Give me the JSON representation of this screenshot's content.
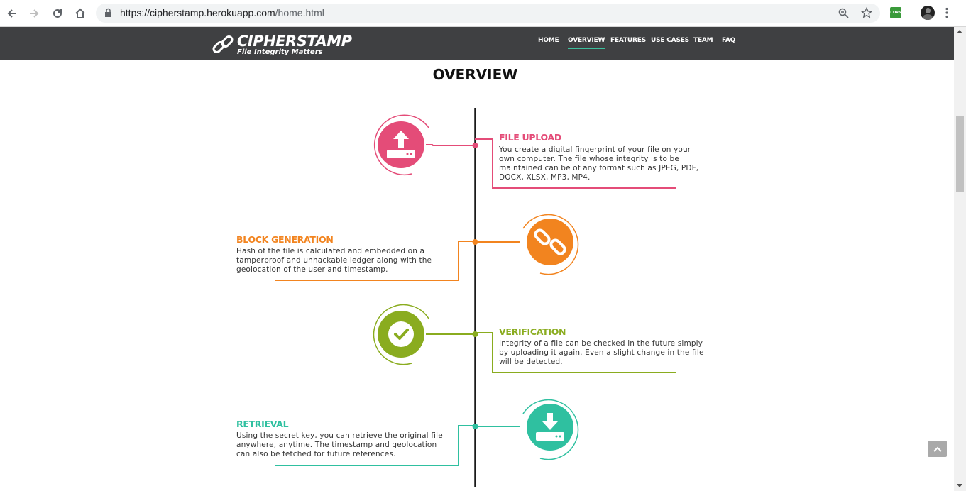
{
  "browser": {
    "url_host": "https://cipherstamp.herokuapp.com",
    "url_path": "/home.html",
    "extension_label": "CORS",
    "icons": [
      "back-icon",
      "forward-icon",
      "reload-icon",
      "home-icon",
      "lock-icon",
      "zoom-icon",
      "star-icon",
      "extension-icon",
      "profile-avatar",
      "menu-kebab-icon"
    ]
  },
  "site": {
    "logo_text": "CIPHERSTAMP",
    "logo_tagline": "File Integrity Matters",
    "nav": [
      {
        "label": "HOME",
        "active": false
      },
      {
        "label": "OVERVIEW",
        "active": true
      },
      {
        "label": "FEATURES",
        "active": false
      },
      {
        "label": "USE CASES",
        "active": false
      },
      {
        "label": "TEAM",
        "active": false
      },
      {
        "label": "FAQ",
        "active": false
      }
    ]
  },
  "overview": {
    "title": "OVERVIEW",
    "steps": [
      {
        "title": "FILE UPLOAD",
        "color": "#e44c78",
        "icon": "upload-icon",
        "side": "right",
        "lines": [
          "You create a digital fingerprint of your file on your",
          "own computer. The file whose integrity is to be",
          "maintained can be of any format such as JPEG, PDF,",
          "DOCX, XLSX, MP3, MP4."
        ]
      },
      {
        "title": "BLOCK GENERATION",
        "color": "#f2841f",
        "icon": "chain-link-icon",
        "side": "left",
        "lines": [
          "Hash of the file is calculated and embedded on a",
          "tamperproof and unhackable ledger along with the",
          "geolocation of the user and timestamp."
        ]
      },
      {
        "title": "VERIFICATION",
        "color": "#8aac1f",
        "icon": "checkmark-icon",
        "side": "right",
        "lines": [
          "Integrity of a file can be checked in the future simply",
          "by uploading it again. Even a slight change in the file",
          "will be detected."
        ]
      },
      {
        "title": "RETRIEVAL",
        "color": "#2fc0a0",
        "icon": "download-icon",
        "side": "left",
        "lines": [
          "Using the secret key, you can retrieve the original file",
          "anywhere, anytime. The timestamp and geolocation",
          "can also be fetched for future references."
        ]
      }
    ]
  },
  "colors": {
    "navbar_bg": "#3f4042",
    "nav_active_underline": "#3bbf9d",
    "timeline_line": "#1a1a1a"
  }
}
